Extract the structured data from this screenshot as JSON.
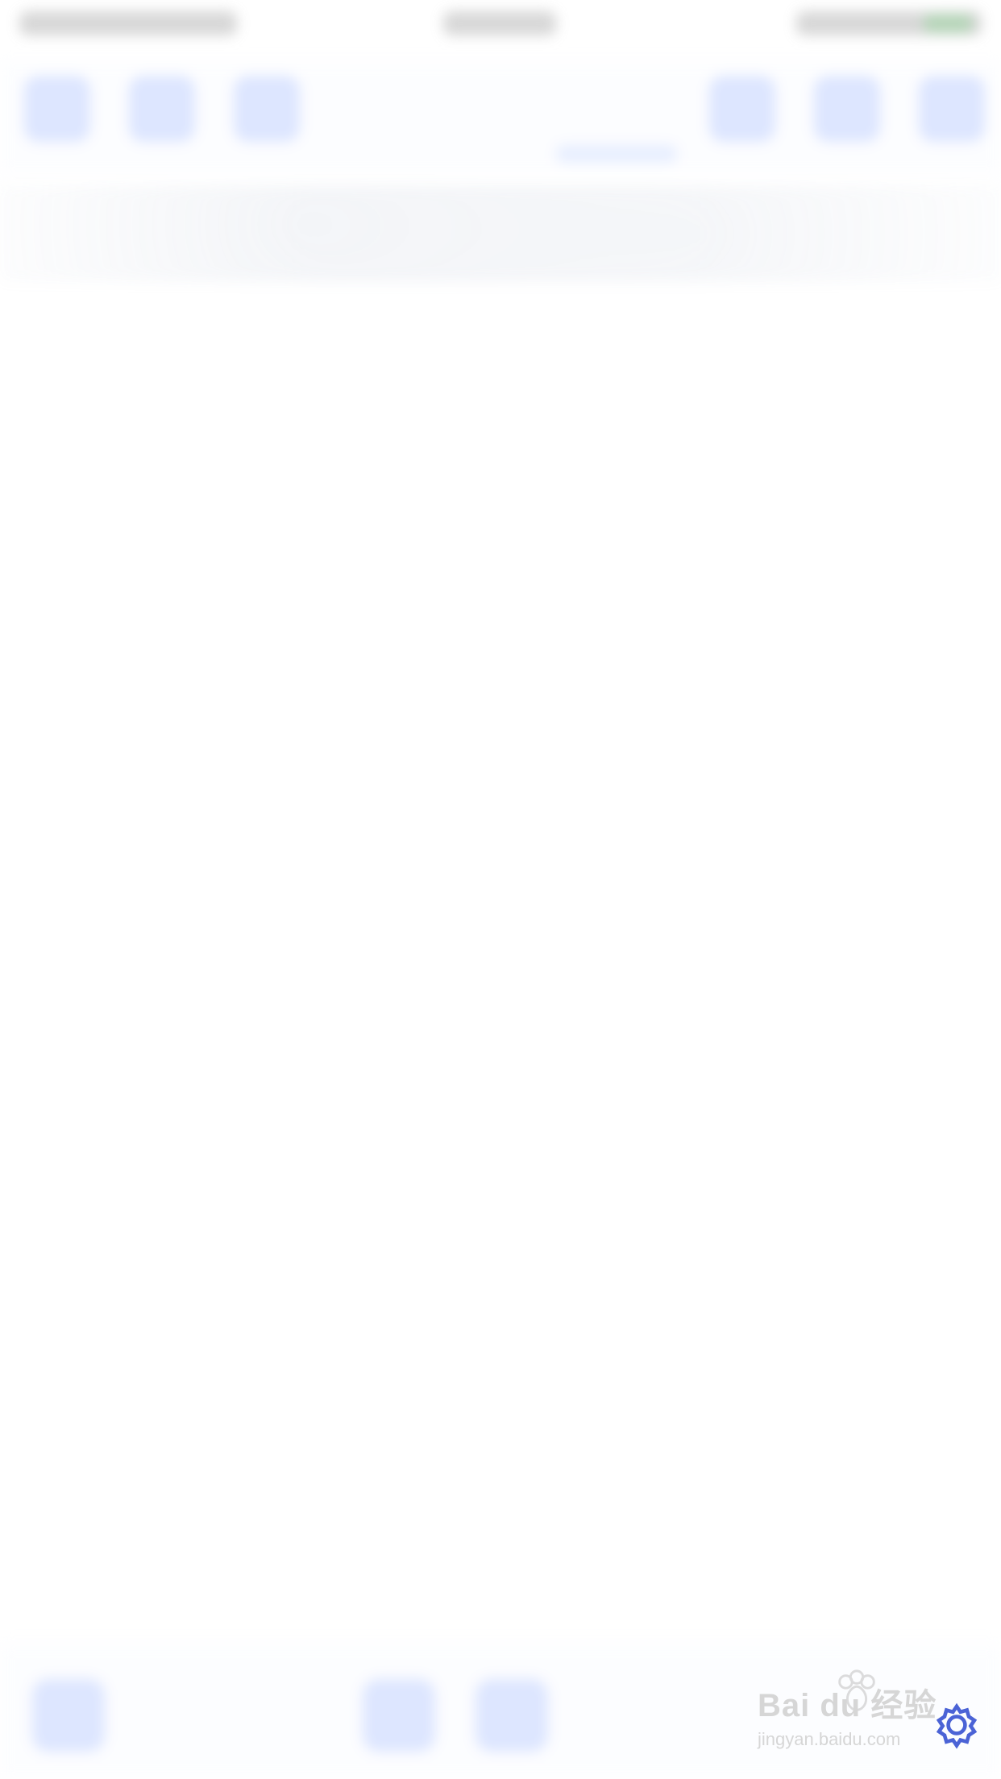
{
  "watermark": {
    "brand": "Bai du 经验",
    "domain": "jingyan.baidu.com"
  },
  "icons": {
    "paw": "paw-icon",
    "gear": "gear-icon"
  },
  "colors": {
    "accent": "#4b63d6",
    "toolbar_tint": "#c7d6ff",
    "watermark_gray": "#d6d6d6",
    "battery_green": "#62b86a"
  }
}
